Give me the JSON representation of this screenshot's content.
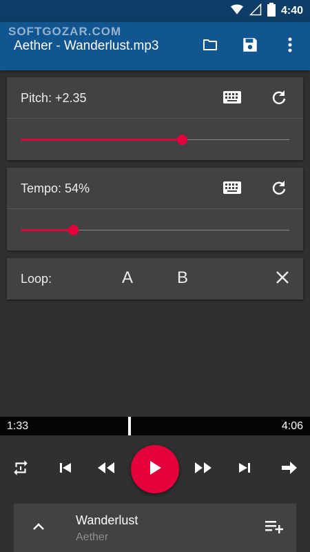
{
  "status": {
    "time": "4:40"
  },
  "watermark": "SOFTGOZAR.COM",
  "app_bar": {
    "title": "Aether - Wanderlust.mp3"
  },
  "pitch": {
    "label": "Pitch: +2.35",
    "level": 0.6
  },
  "tempo": {
    "label": "Tempo: 54%",
    "level": 0.195
  },
  "loop": {
    "label": "Loop:",
    "a": "A",
    "b": "B"
  },
  "seek": {
    "current": "1:33",
    "total": "4:06",
    "progress": 0.378
  },
  "now_playing": {
    "title": "Wanderlust",
    "artist": "Aether"
  },
  "colors": {
    "accent": "#e4003a",
    "app_bar": "#115591",
    "status_bar": "#0d3d66",
    "background": "#303030",
    "card": "#424242"
  },
  "icons": [
    "wifi-icon",
    "signal-icon",
    "battery-icon",
    "folder-icon",
    "save-icon",
    "overflow-menu-icon",
    "keyboard-icon",
    "reset-icon",
    "close-icon",
    "repeat-one-icon",
    "skip-previous-icon",
    "rewind-icon",
    "play-icon",
    "fast-forward-icon",
    "skip-next-icon",
    "arrow-forward-icon",
    "chevron-up-icon",
    "playlist-add-icon"
  ]
}
